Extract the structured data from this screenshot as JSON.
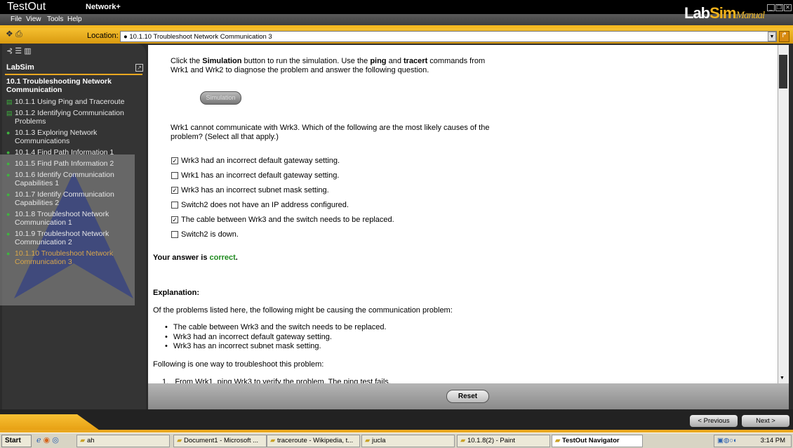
{
  "window": {
    "app_name": "TestOut",
    "product": "Network+",
    "logo": "LabSim Manual",
    "logo_parts": [
      "Lab",
      "Sim",
      "Manual"
    ]
  },
  "menu": [
    "File",
    "View",
    "Tools",
    "Help"
  ],
  "toolbar": {
    "location_label": "Location:",
    "location_value": "10.1.10 Troubleshoot Network Communication 3"
  },
  "sidebar": {
    "title": "LabSim",
    "section": "10.1 Troubleshooting Network Communication",
    "items": [
      {
        "label": "10.1.1 Using Ping and Traceroute",
        "icon": "lab-icon"
      },
      {
        "label": "10.1.2 Identifying Communication Problems",
        "icon": "document-icon"
      },
      {
        "label": "10.1.3 Exploring Network Communications",
        "icon": "simulation-icon"
      },
      {
        "label": "10.1.4 Find Path Information 1",
        "icon": "simulation-icon"
      },
      {
        "label": "10.1.5 Find Path Information 2",
        "icon": "simulation-icon"
      },
      {
        "label": "10.1.6 Identify Communication Capabilities 1",
        "icon": "simulation-icon"
      },
      {
        "label": "10.1.7 Identify Communication Capabilities 2",
        "icon": "simulation-icon"
      },
      {
        "label": "10.1.8 Troubleshoot Network Communication 1",
        "icon": "simulation-icon"
      },
      {
        "label": "10.1.9 Troubleshoot Network Communication 2",
        "icon": "simulation-icon"
      },
      {
        "label": "10.1.10 Troubleshoot Network Communication 3",
        "icon": "simulation-icon",
        "active": true
      }
    ]
  },
  "content": {
    "intro": {
      "a": "Click the ",
      "b": "Simulation",
      "c": " button to run the simulation. Use the ",
      "d": "ping",
      "e": " and ",
      "f": "tracert",
      "g": " commands from",
      "h": "Wrk1 and Wrk2 to diagnose the problem and answer the following question."
    },
    "simulation_button": "Simulation",
    "question_line1": "Wrk1 cannot communicate with Wrk3. Which of the following are the most likely causes of the",
    "question_line2": "problem? (Select all that apply.)",
    "options": [
      {
        "label": "Wrk3 had an incorrect default gateway setting.",
        "checked": true
      },
      {
        "label": "Wrk1 has an incorrect default gateway setting.",
        "checked": false
      },
      {
        "label": "Wrk3 has an incorrect subnet mask setting.",
        "checked": true
      },
      {
        "label": "Switch2 does not have an IP address configured.",
        "checked": false
      },
      {
        "label": "The cable between Wrk3 and the switch needs to be replaced.",
        "checked": true
      },
      {
        "label": "Switch2 is down.",
        "checked": false
      }
    ],
    "result_prefix": "Your answer is ",
    "result_word": "correct",
    "result_suffix": ".",
    "explanation_heading": "Explanation:",
    "explanation_intro": "Of the problems listed here, the following might be causing the communication problem:",
    "explanation_bullets": [
      "The cable between Wrk3 and the switch needs to be replaced.",
      "Wrk3 had an incorrect default gateway setting.",
      "Wrk3 has an incorrect subnet mask setting."
    ],
    "following": "Following is one way to troubleshoot this problem:",
    "step1": "1.   From Wrk1, ping Wrk3 to verify the problem. The ping test fails."
  },
  "reset_button": "Reset",
  "nav": {
    "previous": "< Previous",
    "next": "Next >"
  },
  "taskbar": {
    "start": "Start",
    "tasks": [
      "ah",
      "Document1 - Microsoft ...",
      "traceroute - Wikipedia, t...",
      "jucla",
      "10.1.8(2) - Paint",
      "TestOut Navigator"
    ],
    "clock": "3:14 PM"
  },
  "colors": {
    "accent": "#f5b820",
    "correct": "#1e8a1e",
    "active_item": "#d9a74a"
  }
}
